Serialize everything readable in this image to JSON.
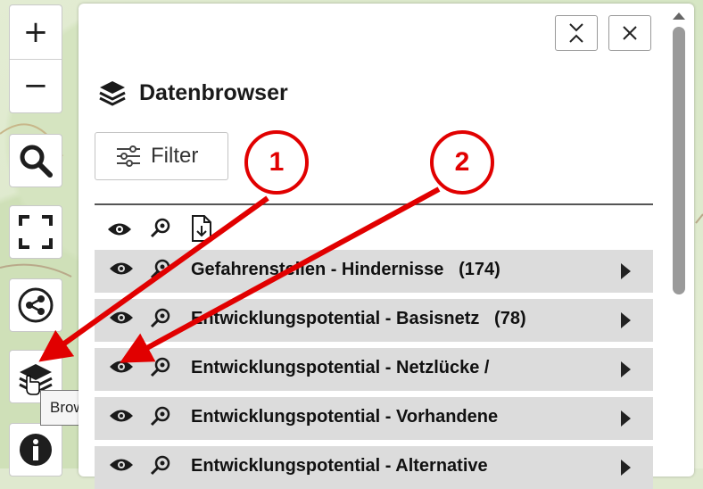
{
  "map_controls": {
    "zoom_in_label": "+",
    "zoom_out_label": "−",
    "search_icon": "search-icon",
    "fullscreen_icon": "fullscreen-icon",
    "share_icon": "share-icon",
    "layers_icon": "layers-icon",
    "info_icon": "info-icon"
  },
  "tooltip": {
    "text": "Browser öffnen"
  },
  "panel": {
    "title": "Datenbrowser",
    "filter_label": "Filter",
    "layers": [
      {
        "label": "Gefahrenstellen - Hindernisse   (174)"
      },
      {
        "label": "Entwicklungspotential - Basisnetz   (78)"
      },
      {
        "label": "Entwicklungspotential - Netzlücke /"
      },
      {
        "label": "Entwicklungspotential - Vorhandene"
      },
      {
        "label": "Entwicklungspotential - Alternative"
      }
    ]
  },
  "annotations": {
    "callout_1": "1",
    "callout_2": "2",
    "color": "#e10000"
  }
}
